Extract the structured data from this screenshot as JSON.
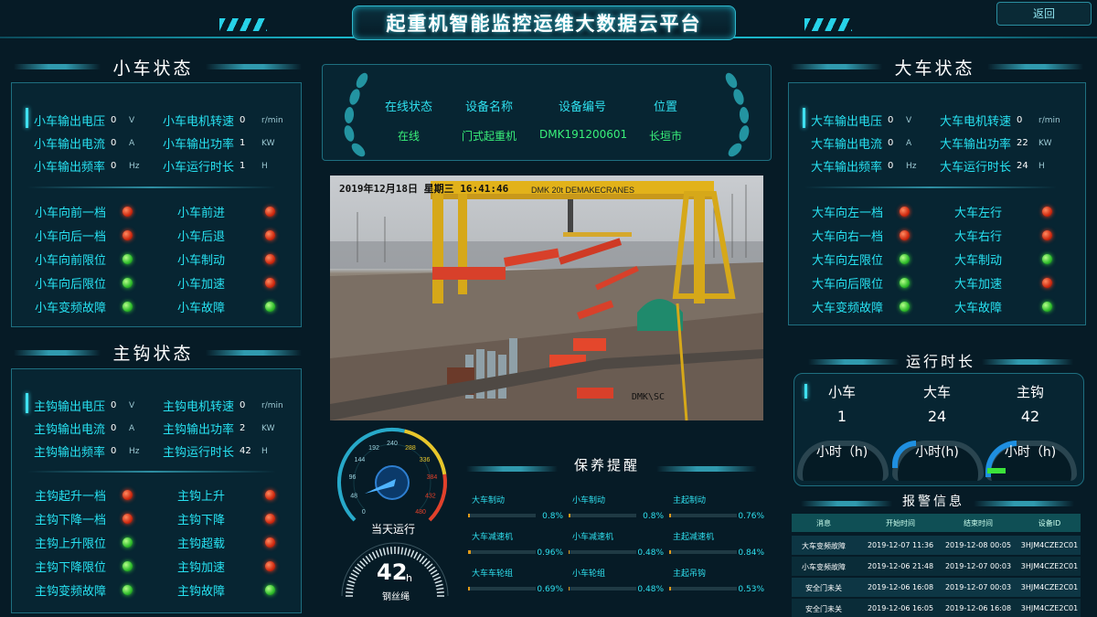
{
  "header": {
    "title": "起重机智能监控运维大数据云平台",
    "back_label": "返回"
  },
  "trolley": {
    "title": "小车状态",
    "metrics": [
      {
        "label": "小车输出电压",
        "value": "0",
        "unit": "V"
      },
      {
        "label": "小车电机转速",
        "value": "0",
        "unit": "r/min"
      },
      {
        "label": "小车输出电流",
        "value": "0",
        "unit": "A"
      },
      {
        "label": "小车输出功率",
        "value": "1",
        "unit": "KW"
      },
      {
        "label": "小车输出频率",
        "value": "0",
        "unit": "Hz"
      },
      {
        "label": "小车运行时长",
        "value": "1",
        "unit": "H"
      }
    ],
    "signals": [
      {
        "label": "小车向前一档",
        "state": "red"
      },
      {
        "label": "小车前进",
        "state": "red"
      },
      {
        "label": "小车向后一档",
        "state": "red"
      },
      {
        "label": "小车后退",
        "state": "red"
      },
      {
        "label": "小车向前限位",
        "state": "green"
      },
      {
        "label": "小车制动",
        "state": "red"
      },
      {
        "label": "小车向后限位",
        "state": "green"
      },
      {
        "label": "小车加速",
        "state": "red"
      },
      {
        "label": "小车变频故障",
        "state": "green"
      },
      {
        "label": "小车故障",
        "state": "green"
      }
    ]
  },
  "hook": {
    "title": "主钩状态",
    "metrics": [
      {
        "label": "主钩输出电压",
        "value": "0",
        "unit": "V"
      },
      {
        "label": "主钩电机转速",
        "value": "0",
        "unit": "r/min"
      },
      {
        "label": "主钩输出电流",
        "value": "0",
        "unit": "A"
      },
      {
        "label": "主钩输出功率",
        "value": "2",
        "unit": "KW"
      },
      {
        "label": "主钩输出频率",
        "value": "0",
        "unit": "Hz"
      },
      {
        "label": "主钩运行时长",
        "value": "42",
        "unit": "H"
      }
    ],
    "signals": [
      {
        "label": "主钩起升一档",
        "state": "red"
      },
      {
        "label": "主钩上升",
        "state": "red"
      },
      {
        "label": "主钩下降一档",
        "state": "red"
      },
      {
        "label": "主钩下降",
        "state": "red"
      },
      {
        "label": "主钩上升限位",
        "state": "green"
      },
      {
        "label": "主钩超载",
        "state": "red"
      },
      {
        "label": "主钩下降限位",
        "state": "green"
      },
      {
        "label": "主钩加速",
        "state": "red"
      },
      {
        "label": "主钩变频故障",
        "state": "green"
      },
      {
        "label": "主钩故障",
        "state": "green"
      }
    ]
  },
  "gantry": {
    "title": "大车状态",
    "metrics": [
      {
        "label": "大车输出电压",
        "value": "0",
        "unit": "V"
      },
      {
        "label": "大车电机转速",
        "value": "0",
        "unit": "r/min"
      },
      {
        "label": "大车输出电流",
        "value": "0",
        "unit": "A"
      },
      {
        "label": "大车输出功率",
        "value": "22",
        "unit": "KW"
      },
      {
        "label": "大车输出频率",
        "value": "0",
        "unit": "Hz"
      },
      {
        "label": "大车运行时长",
        "value": "24",
        "unit": "H"
      }
    ],
    "signals": [
      {
        "label": "大车向左一档",
        "state": "red"
      },
      {
        "label": "大车左行",
        "state": "red"
      },
      {
        "label": "大车向右一档",
        "state": "red"
      },
      {
        "label": "大车右行",
        "state": "red"
      },
      {
        "label": "大车向左限位",
        "state": "green"
      },
      {
        "label": "大车制动",
        "state": "green"
      },
      {
        "label": "大车向后限位",
        "state": "green"
      },
      {
        "label": "大车加速",
        "state": "red"
      },
      {
        "label": "大车变频故障",
        "state": "green"
      },
      {
        "label": "大车故障",
        "state": "green"
      }
    ]
  },
  "device": {
    "headers": [
      "在线状态",
      "设备名称",
      "设备编号",
      "位置"
    ],
    "values": [
      "在线",
      "门式起重机",
      "DMK191200601",
      "长垣市"
    ]
  },
  "camera": {
    "timestamp": "2019年12月18日  星期三  16:41:46",
    "tag": "DMK\\SC",
    "banner": "DMK   20t  DEMAKECRANES"
  },
  "speedo": {
    "ticks": [
      "0",
      "48",
      "96",
      "144",
      "192",
      "240",
      "288",
      "336",
      "384",
      "432",
      "480"
    ],
    "label": "当天运行"
  },
  "rope": {
    "value": "42",
    "unit": "h",
    "label": "钢丝绳"
  },
  "runtime": {
    "title": "运行时长",
    "items": [
      {
        "name": "小车",
        "value": "1",
        "unit": "小时（h)"
      },
      {
        "name": "大车",
        "value": "24",
        "unit": "小时(h)"
      },
      {
        "name": "主钩",
        "value": "42",
        "unit": "小时（h)"
      }
    ]
  },
  "maintenance": {
    "title": "保养提醒",
    "items": [
      {
        "label": "大车制动",
        "pct": "0.8%",
        "level": 0.8
      },
      {
        "label": "小车制动",
        "pct": "0.8%",
        "level": 0.8
      },
      {
        "label": "主起制动",
        "pct": "0.76%",
        "level": 0.76
      },
      {
        "label": "大车减速机",
        "pct": "0.96%",
        "level": 0.96
      },
      {
        "label": "小车减速机",
        "pct": "0.48%",
        "level": 0.48
      },
      {
        "label": "主起减速机",
        "pct": "0.84%",
        "level": 0.84
      },
      {
        "label": "大车车轮组",
        "pct": "0.69%",
        "level": 0.69
      },
      {
        "label": "小车轮组",
        "pct": "0.48%",
        "level": 0.48
      },
      {
        "label": "主起吊钩",
        "pct": "0.53%",
        "level": 0.53
      }
    ]
  },
  "alarms": {
    "title": "报警信息",
    "headers": [
      "消息",
      "开始时间",
      "结束时间",
      "设备ID"
    ],
    "rows": [
      [
        "大车变频故障",
        "2019-12-07 11:36",
        "2019-12-08 00:05",
        "3HJM4CZE2C01"
      ],
      [
        "小车变频故障",
        "2019-12-06 21:48",
        "2019-12-07 00:03",
        "3HJM4CZE2C01"
      ],
      [
        "安全门未关",
        "2019-12-06 16:08",
        "2019-12-07 00:03",
        "3HJM4CZE2C01"
      ],
      [
        "安全门未关",
        "2019-12-06 16:05",
        "2019-12-06 16:08",
        "3HJM4CZE2C01"
      ]
    ]
  },
  "colors": {
    "accent": "#27e2f2",
    "alarm": "#d02a10",
    "ok": "#2fbd2c",
    "bg": "#061b26"
  }
}
